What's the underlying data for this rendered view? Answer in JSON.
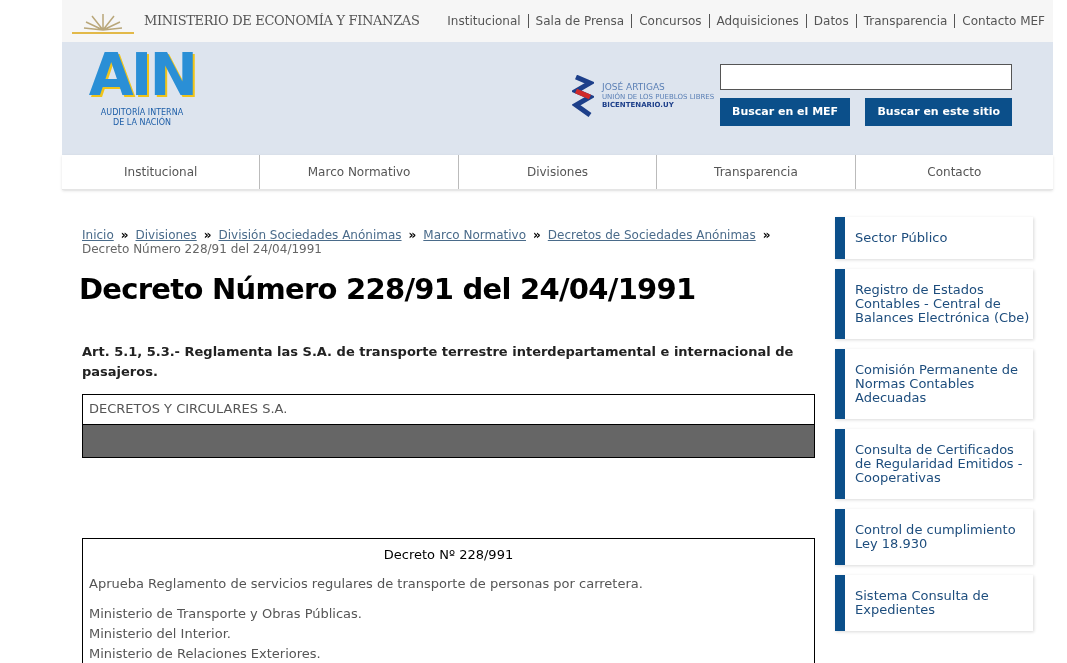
{
  "ministry": {
    "name": "MINISTERIO DE ECONOMÍA Y FINANZAS"
  },
  "top_links": [
    "Institucional",
    "Sala de Prensa",
    "Concursos",
    "Adquisiciones",
    "Datos",
    "Transparencia",
    "Contacto MEF"
  ],
  "logo": {
    "mark": "AIN",
    "caption": "AUDITORÍA INTERNA DE LA NACIÓN"
  },
  "bicentenario": {
    "title": "JOSÉ ARTIGAS",
    "subtitle": "UNIÓN DE LOS PUEBLOS LIBRES",
    "site": "BICENTENARIO.UY"
  },
  "search": {
    "buttons": [
      "Buscar en el MEF",
      "Buscar en este sitio"
    ]
  },
  "nav": [
    "Institucional",
    "Marco Normativo",
    "Divisiones",
    "Transparencia",
    "Contacto"
  ],
  "breadcrumb": {
    "links": [
      "Inicio",
      "Divisiones",
      "División Sociedades Anónimas",
      "Marco Normativo",
      "Decretos de Sociedades Anónimas"
    ],
    "separator": "»",
    "current": "Decreto Número 228/91 del 24/04/1991"
  },
  "title": "Decreto Número 228/91 del 24/04/1991",
  "summary": "Art. 5.1, 5.3.- Reglamenta las S.A. de transporte terrestre interdepartamental e internacional de pasajeros.",
  "category_box": {
    "label": "DECRETOS Y CIRCULARES S.A."
  },
  "decree": {
    "heading": "Decreto Nº 228/991",
    "description": "Aprueba Reglamento de servicios regulares de transporte de personas por carretera.",
    "ministries": [
      "Ministerio de Transporte y Obras Públicas.",
      "Ministerio del Interior.",
      "Ministerio de Relaciones Exteriores."
    ]
  },
  "sidebar": [
    "Sector Público",
    "Registro de Estados Contables - Central de Balances Electrónica (Cbe)",
    "Comisión Permanente de Normas Contables Adecuadas",
    "Consulta de Certificados de Regularidad Emitidos - Cooperativas",
    "Control de cumplimiento Ley 18.930",
    "Sistema Consulta de Expedientes"
  ]
}
